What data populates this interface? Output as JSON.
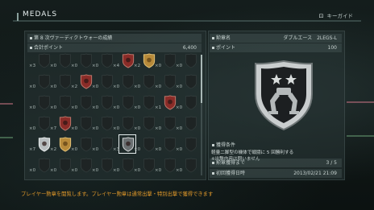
{
  "header": {
    "title": "MEDALS",
    "guide_button": "⊡",
    "guide_label": "キーガイド"
  },
  "left": {
    "season_label": "第 8 次ヴァーディクトウォーの成績",
    "total_points_label": "合計ポイント",
    "total_points_value": "6,400"
  },
  "medal_rows": [
    [
      {
        "count": "×3",
        "medal": "blank"
      },
      {
        "count": "×0",
        "medal": "blank"
      },
      {
        "count": "×0",
        "medal": "blank"
      },
      {
        "count": "×0",
        "medal": "blank"
      },
      {
        "count": "×4",
        "medal": "red"
      },
      {
        "count": "×2",
        "medal": "gold"
      },
      {
        "count": "×0",
        "medal": "blank"
      },
      {
        "count": "×0",
        "medal": "blank"
      }
    ],
    [
      {
        "count": "×0",
        "medal": "blank"
      },
      {
        "count": "×0",
        "medal": "blank"
      },
      {
        "count": "×2",
        "medal": "red"
      },
      {
        "count": "×0",
        "medal": "blank"
      },
      {
        "count": "×0",
        "medal": "blank"
      },
      {
        "count": "×0",
        "medal": "blank"
      },
      {
        "count": "×0",
        "medal": "blank"
      },
      {
        "count": "×0",
        "medal": "blank"
      }
    ],
    [
      {
        "count": "×0",
        "medal": "blank"
      },
      {
        "count": "×0",
        "medal": "blank"
      },
      {
        "count": "×0",
        "medal": "blank"
      },
      {
        "count": "×0",
        "medal": "blank"
      },
      {
        "count": "×0",
        "medal": "blank"
      },
      {
        "count": "×0",
        "medal": "blank"
      },
      {
        "count": "×1",
        "medal": "red"
      },
      {
        "count": "×0",
        "medal": "blank"
      }
    ],
    [
      {
        "count": "×0",
        "medal": "blank"
      },
      {
        "count": "×7",
        "medal": "red"
      },
      {
        "count": "×0",
        "medal": "blank"
      },
      {
        "count": "×0",
        "medal": "blank"
      },
      {
        "count": "×0",
        "medal": "blank"
      },
      {
        "count": "×0",
        "medal": "blank"
      },
      {
        "count": "×0",
        "medal": "blank"
      },
      {
        "count": "×0",
        "medal": "blank"
      }
    ],
    [
      {
        "count": "×7",
        "medal": "silver"
      },
      {
        "count": "×2",
        "medal": "gold"
      },
      {
        "count": "×0",
        "medal": "blank"
      },
      {
        "count": "×0",
        "medal": "blank"
      },
      {
        "count": "×3",
        "medal": "silver-selected"
      },
      {
        "count": "×0",
        "medal": "blank"
      },
      {
        "count": "×0",
        "medal": "blank"
      },
      {
        "count": "×0",
        "medal": "blank"
      }
    ],
    [
      {
        "count": "×0",
        "medal": "blank"
      },
      {
        "count": "×0",
        "medal": "blank"
      },
      {
        "count": "×0",
        "medal": "blank"
      },
      {
        "count": "×0",
        "medal": "blank"
      },
      {
        "count": "×0",
        "medal": "blank"
      },
      {
        "count": "×0",
        "medal": "blank"
      },
      {
        "count": "×0",
        "medal": "blank"
      },
      {
        "count": "×0",
        "medal": "blank"
      }
    ]
  ],
  "detail": {
    "name_label": "勲章名",
    "name_value": "ダブルエース　2LEGS-L",
    "points_label": "ポイント",
    "points_value": "100",
    "condition_label": "獲得条件",
    "condition_line1": "軽量二脚型の機体で戦闘に 5 回勝利する",
    "condition_line2": "※出撃内容は問いません",
    "progress_label": "勲章獲得まで",
    "progress_value": "3 / 5",
    "first_date_label": "初回獲得日時",
    "first_date_value": "2013/02/21 21:09"
  },
  "footer": {
    "text": "プレイヤー勲章を閲覧します。プレイヤー勲章は通常出撃・特別出撃で獲得できます"
  },
  "colors": {
    "accent_orange": "#e39a2a",
    "medal_red": "#8a2c28",
    "medal_gold": "#b78a3a",
    "medal_silver": "#b8bec0",
    "hud_green": "#5f8f6a",
    "hud_pink": "#b46a78"
  }
}
